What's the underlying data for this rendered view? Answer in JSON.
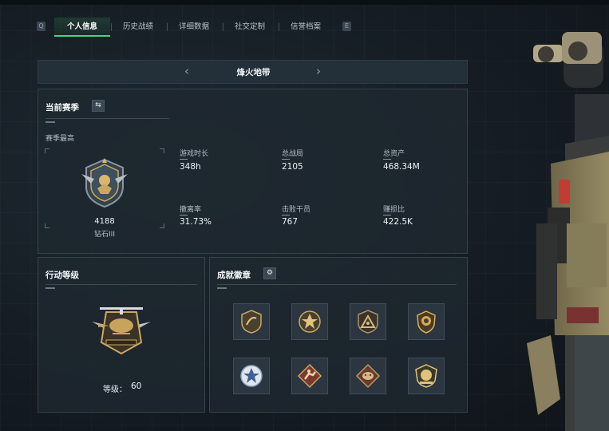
{
  "tabs": {
    "prev_key": "Q",
    "next_key": "E",
    "items": [
      {
        "label": "个人信息",
        "active": true
      },
      {
        "label": "历史战绩",
        "active": false
      },
      {
        "label": "详细数据",
        "active": false
      },
      {
        "label": "社交定制",
        "active": false
      },
      {
        "label": "信誉档案",
        "active": false
      }
    ]
  },
  "map": {
    "title": "烽火地带",
    "prev_arrow": "‹",
    "next_arrow": "›"
  },
  "season": {
    "title": "当前赛季",
    "switch_icon": "swap-arrows-icon",
    "best_label": "赛季最高",
    "rank_points": "4188",
    "rank_name": "钻石III",
    "stats": [
      {
        "label": "游戏时长",
        "value": "348h"
      },
      {
        "label": "总战局",
        "value": "2105"
      },
      {
        "label": "总资产",
        "value": "468.34M"
      },
      {
        "label": "撤离率",
        "value": "31.73%"
      },
      {
        "label": "击败干员",
        "value": "767"
      },
      {
        "label": "赚损比",
        "value": "422.5K"
      }
    ]
  },
  "operation": {
    "title": "行动等级",
    "level_label": "等级：",
    "level_value": "60"
  },
  "achievements": {
    "title": "成就徽章",
    "settings_icon": "gear-icon",
    "badges": [
      "shield-badge-icon",
      "star-badge-icon",
      "triangle-badge-icon",
      "crest-badge-icon",
      "blue-star-badge-icon",
      "runner-badge-icon",
      "beast-badge-icon",
      "gold-emblem-badge-icon"
    ]
  },
  "colors": {
    "accent_green": "#4fd07f",
    "panel_bg": "#1e2830",
    "gold": "#c9a860"
  }
}
